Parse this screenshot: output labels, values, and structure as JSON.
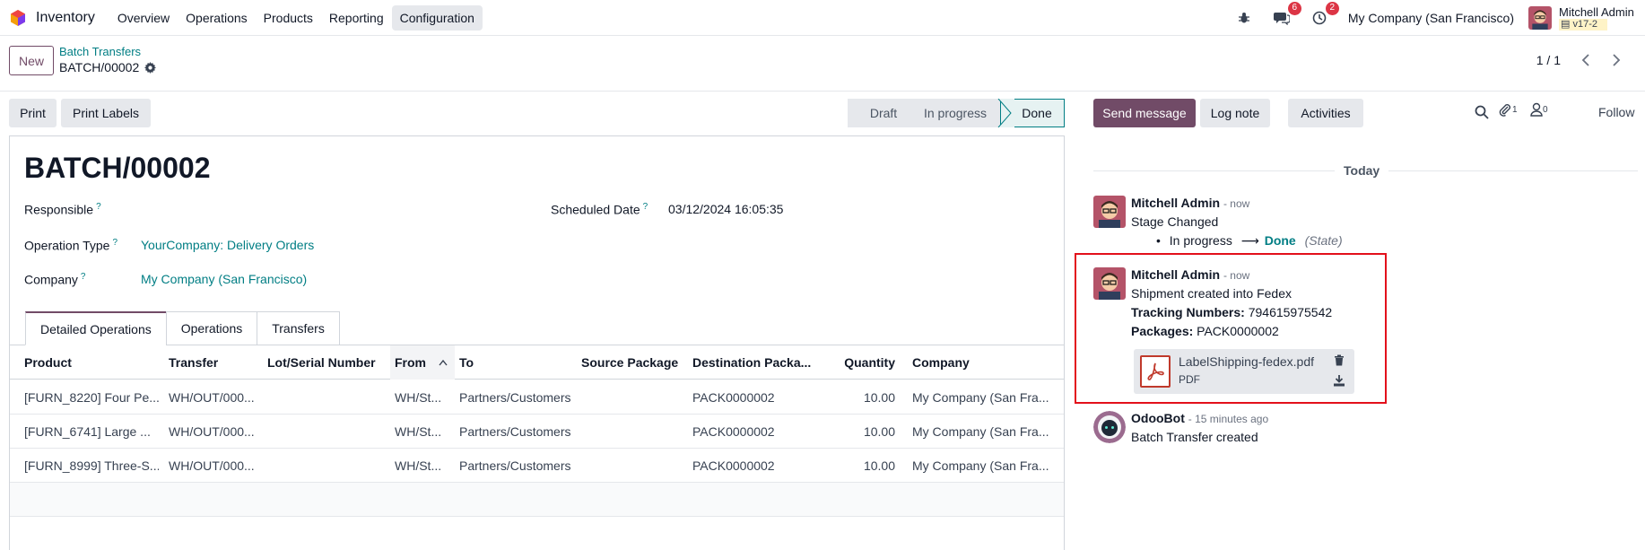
{
  "navbar": {
    "app_name": "Inventory",
    "menu": [
      "Overview",
      "Operations",
      "Products",
      "Reporting",
      "Configuration"
    ],
    "messages_count": "6",
    "activities_count": "2",
    "company": "My Company (San Francisco)",
    "user_name": "Mitchell Admin",
    "db_version": "v17-2"
  },
  "control": {
    "new_label": "New",
    "breadcrumb_parent": "Batch Transfers",
    "breadcrumb_current": "BATCH/00002",
    "pager": "1 / 1"
  },
  "buttons": {
    "print": "Print",
    "print_labels": "Print Labels"
  },
  "stages": [
    "Draft",
    "In progress",
    "Done"
  ],
  "record": {
    "title": "BATCH/00002",
    "responsible_label": "Responsible",
    "scheduled_label": "Scheduled Date",
    "scheduled_value": "03/12/2024 16:05:35",
    "operation_type_label": "Operation Type",
    "operation_type_value": "YourCompany: Delivery Orders",
    "company_label": "Company",
    "company_value": "My Company (San Francisco)",
    "help_mark": "?"
  },
  "tabs": [
    "Detailed Operations",
    "Operations",
    "Transfers"
  ],
  "table": {
    "headers": [
      "Product",
      "Transfer",
      "Lot/Serial Number",
      "From",
      "To",
      "Source Package",
      "Destination Packa...",
      "Quantity",
      "Company"
    ],
    "rows": [
      [
        "[FURN_8220] Four Pe...",
        "WH/OUT/000...",
        "",
        "WH/St...",
        "Partners/Customers",
        "",
        "PACK0000002",
        "10.00",
        "My Company (San Fra..."
      ],
      [
        "[FURN_6741] Large ...",
        "WH/OUT/000...",
        "",
        "WH/St...",
        "Partners/Customers",
        "",
        "PACK0000002",
        "10.00",
        "My Company (San Fra..."
      ],
      [
        "[FURN_8999] Three-S...",
        "WH/OUT/000...",
        "",
        "WH/St...",
        "Partners/Customers",
        "",
        "PACK0000002",
        "10.00",
        "My Company (San Fra..."
      ]
    ]
  },
  "chatter": {
    "send_message": "Send message",
    "log_note": "Log note",
    "activities": "Activities",
    "attachments_count": "1",
    "followers_count": "0",
    "follow": "Follow",
    "today": "Today",
    "messages": [
      {
        "author": "Mitchell Admin",
        "date": "- now",
        "body": "Stage Changed",
        "tracking_old": "In progress",
        "tracking_new": "Done",
        "tracking_field": "(State)"
      },
      {
        "author": "Mitchell Admin",
        "date": "- now",
        "body": "Shipment created into Fedex",
        "tracking_label": "Tracking Numbers:",
        "tracking_value": "794615975542",
        "packages_label": "Packages:",
        "packages_value": "PACK0000002",
        "attachment_name": "LabelShipping-fedex.pdf",
        "attachment_type": "PDF"
      },
      {
        "author": "OdooBot",
        "date": "- 15 minutes ago",
        "body": "Batch Transfer created"
      }
    ]
  },
  "colors": {
    "brand": "#714b67",
    "link": "#017e84",
    "highlight": "#e3101b",
    "badge": "#dc3545"
  }
}
